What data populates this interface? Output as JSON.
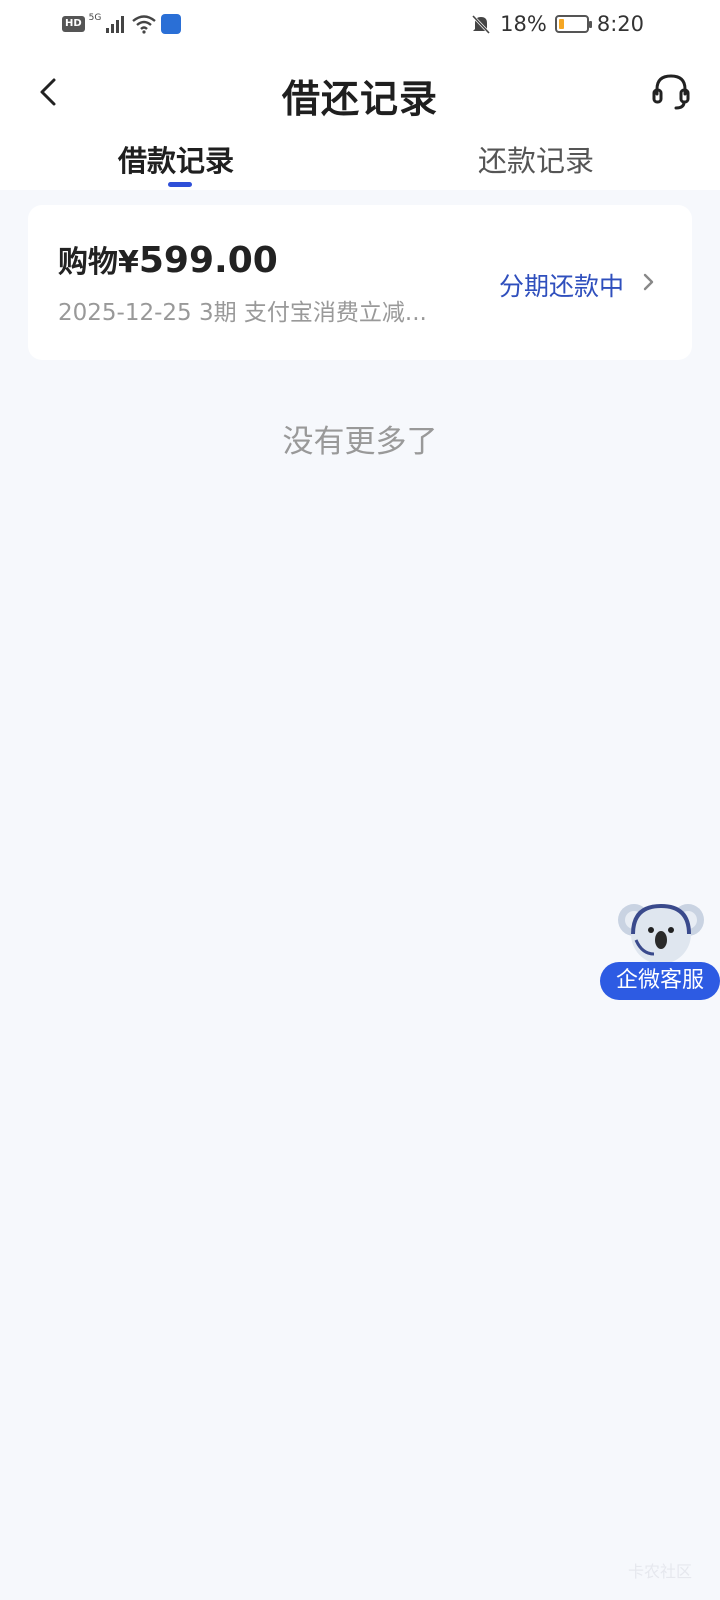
{
  "status_bar": {
    "hd": "HD",
    "network": "5G",
    "battery_text": "18%",
    "battery_level": 0.18,
    "time": "8:20"
  },
  "header": {
    "title": "借还记录",
    "back_icon": "chevron-left-icon",
    "service_icon": "headset-icon"
  },
  "tabs": [
    {
      "label": "借款记录",
      "active": true
    },
    {
      "label": "还款记录",
      "active": false
    }
  ],
  "records": [
    {
      "amount_prefix": "购物¥",
      "amount": "599.00",
      "subtitle": "2025-12-25 3期  支付宝消费立减...",
      "status": "分期还款中"
    }
  ],
  "no_more": "没有更多了",
  "floating_service": {
    "label": "企微客服",
    "icon": "koala-avatar-icon"
  },
  "watermark": "卡农社区",
  "colors": {
    "accent": "#2f4fd8",
    "status_text": "#2f4fbd",
    "background": "#f6f8fc",
    "battery": "#f5a623"
  }
}
